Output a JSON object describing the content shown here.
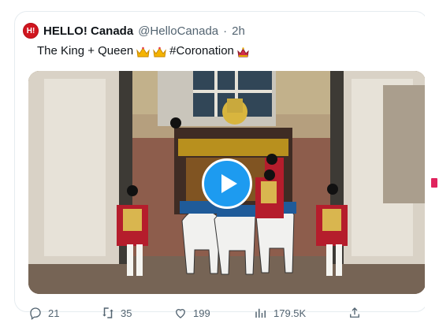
{
  "tweet": {
    "author_name": "HELLO! Canada",
    "author_handle": "@HelloCanada",
    "separator": "·",
    "time": "2h",
    "logo_text": "H!",
    "text_prefix": "The King + Queen",
    "text_suffix": "#Coronation",
    "emojis": [
      "crown-icon",
      "crown-icon",
      "crown-icon"
    ]
  },
  "actions": {
    "reply_count": "21",
    "retweet_count": "35",
    "like_count": "199",
    "view_count": "179.5K"
  },
  "colors": {
    "accent": "#1d9bf0",
    "brand_red": "#d0161f"
  }
}
